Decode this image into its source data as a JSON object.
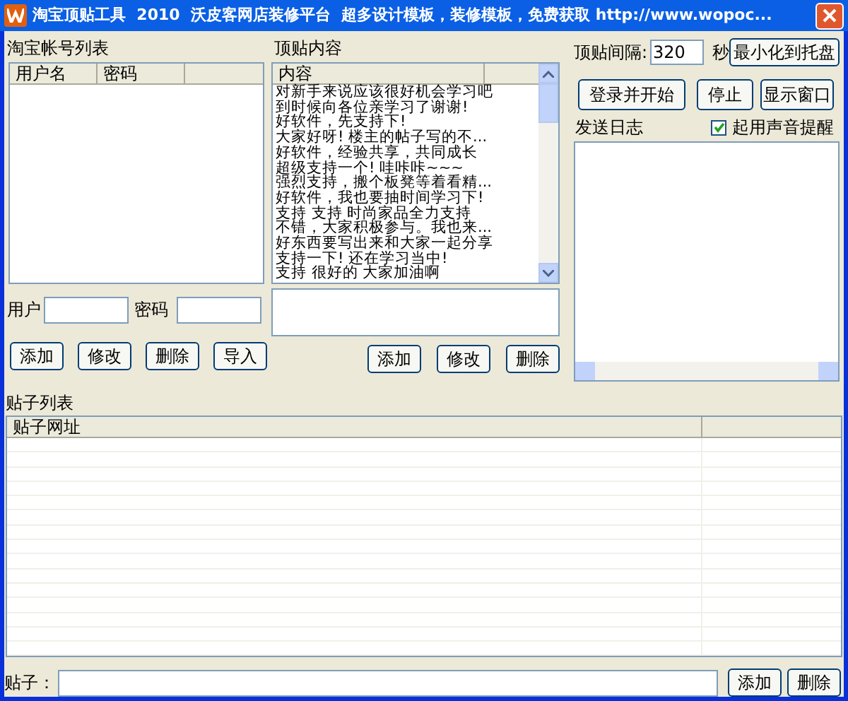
{
  "window": {
    "title": "淘宝顶贴工具  2010  沃皮客网店装修平台  超多设计模板，装修模板，免费获取 http://www.wopoc..."
  },
  "accounts": {
    "label": "淘宝帐号列表",
    "columns": [
      "用户名",
      "密码"
    ],
    "user_label": "用户",
    "password_label": "密码",
    "buttons": [
      "添加",
      "修改",
      "删除",
      "导入"
    ]
  },
  "posts_content": {
    "label": "顶贴内容",
    "column": "内容",
    "rows": [
      "对新手来说应该很好机会学习吧",
      "到时候向各位亲学习了谢谢!",
      "好软件，先支持下!",
      "大家好呀! 楼主的帖子写的不...",
      "好软件，经验共享，共同成长",
      "超级支持一个! 哇咔咔~~~",
      "强烈支持，搬个板凳等着看精...",
      "好软件，我也要抽时间学习下!",
      "支持 支持 时尚家品全力支持",
      "不错，大家积极参与。我也来...",
      "好东西要写出来和大家一起分享",
      "支持一下! 还在学习当中!",
      "支持 很好的 大家加油啊"
    ],
    "buttons": [
      "添加",
      "修改",
      "删除"
    ]
  },
  "settings": {
    "interval_label": "顶贴间隔:",
    "interval_value": "320",
    "interval_unit": "秒",
    "minimize_button": "最小化到托盘",
    "buttons": [
      "登录并开始",
      "停止",
      "显示窗口"
    ],
    "log_label": "发送日志",
    "sound": {
      "label": "起用声音提醒",
      "checked": true
    }
  },
  "post_list": {
    "label": "贴子列表",
    "column": "贴子网址",
    "input_label": "贴子：",
    "buttons": [
      "添加",
      "删除"
    ]
  }
}
